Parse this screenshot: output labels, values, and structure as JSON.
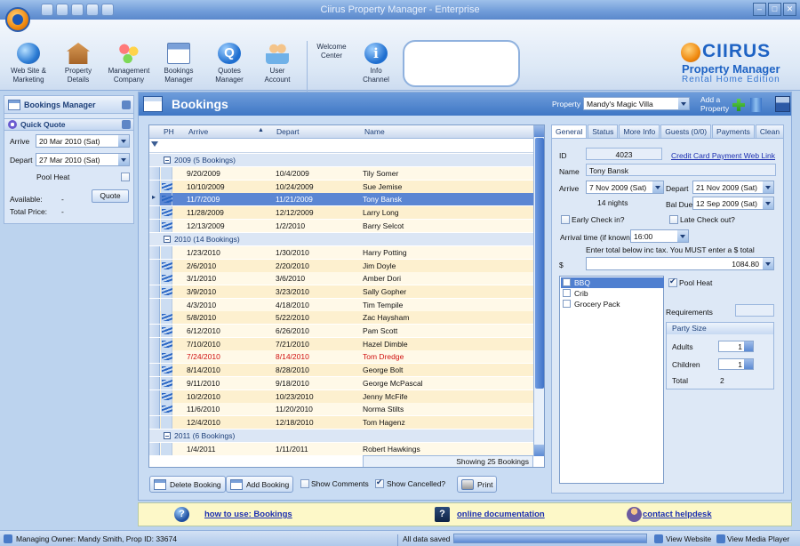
{
  "window": {
    "title": "Ciirus Property Manager  -  Enterprise"
  },
  "ribbon": {
    "buttons": [
      {
        "line1": "Web Site &",
        "line2": "Marketing",
        "icon": "globe-icon"
      },
      {
        "line1": "Property",
        "line2": "Details",
        "icon": "house-icon"
      },
      {
        "line1": "Management",
        "line2": "Company",
        "icon": "management-icon"
      },
      {
        "line1": "Bookings",
        "line2": "Manager",
        "icon": "calendar-icon"
      },
      {
        "line1": "Quotes",
        "line2": "Manager",
        "icon": "quotes-icon"
      },
      {
        "line1": "User",
        "line2": "Account",
        "icon": "user-icon"
      },
      {
        "line1": "Welcome",
        "line2": "Center",
        "icon": "help-icon"
      },
      {
        "line1": "Info",
        "line2": "Channel",
        "icon": "info-icon"
      }
    ],
    "logo": {
      "brand": "CIIRUS",
      "line1": "Property Manager",
      "line2": "Rental Home Edition"
    }
  },
  "left_panel": {
    "title": "Bookings Manager",
    "quick_quote": "Quick Quote",
    "arrive_label": "Arrive",
    "arrive_value": "20 Mar 2010 (Sat)",
    "depart_label": "Depart",
    "depart_value": "27 Mar 2010 (Sat)",
    "pool_heat": "Pool Heat",
    "quote_button": "Quote",
    "available_label": "Available:",
    "available_value": "-",
    "total_label": "Total Price:",
    "total_value": "-"
  },
  "main": {
    "title": "Bookings",
    "property_label": "Property",
    "property_value": "Mandy's Magic Villa",
    "add_property_1": "Add a",
    "add_property_2": "Property"
  },
  "grid": {
    "columns": {
      "ph": "PH",
      "arrive": "Arrive",
      "depart": "Depart",
      "name": "Name"
    },
    "groups": [
      {
        "label": "2009  (5 Bookings)",
        "rows": [
          {
            "arrive": "9/20/2009",
            "depart": "10/4/2009",
            "name": "Tily Somer",
            "ph": false
          },
          {
            "arrive": "10/10/2009",
            "depart": "10/24/2009",
            "name": "Sue Jemise",
            "ph": true
          },
          {
            "arrive": "11/7/2009",
            "depart": "11/21/2009",
            "name": "Tony Bansk",
            "ph": true,
            "selected": true
          },
          {
            "arrive": "11/28/2009",
            "depart": "12/12/2009",
            "name": "Larry Long",
            "ph": true
          },
          {
            "arrive": "12/13/2009",
            "depart": "1/2/2010",
            "name": "Barry Selcot",
            "ph": true
          }
        ]
      },
      {
        "label": "2010  (14 Bookings)",
        "rows": [
          {
            "arrive": "1/23/2010",
            "depart": "1/30/2010",
            "name": "Harry Potting",
            "ph": false
          },
          {
            "arrive": "2/6/2010",
            "depart": "2/20/2010",
            "name": "Jim Doyle",
            "ph": true
          },
          {
            "arrive": "3/1/2010",
            "depart": "3/6/2010",
            "name": "Amber Dori",
            "ph": true
          },
          {
            "arrive": "3/9/2010",
            "depart": "3/23/2010",
            "name": "Sally Gopher",
            "ph": true
          },
          {
            "arrive": "4/3/2010",
            "depart": "4/18/2010",
            "name": "Tim Tempile",
            "ph": false
          },
          {
            "arrive": "5/8/2010",
            "depart": "5/22/2010",
            "name": "Zac Haysham",
            "ph": true
          },
          {
            "arrive": "6/12/2010",
            "depart": "6/26/2010",
            "name": "Pam Scott",
            "ph": true
          },
          {
            "arrive": "7/10/2010",
            "depart": "7/21/2010",
            "name": "Hazel Dimble",
            "ph": true
          },
          {
            "arrive": "7/24/2010",
            "depart": "8/14/2010",
            "name": "Tom Dredge",
            "ph": true,
            "red": true
          },
          {
            "arrive": "8/14/2010",
            "depart": "8/28/2010",
            "name": "George Bolt",
            "ph": true
          },
          {
            "arrive": "9/11/2010",
            "depart": "9/18/2010",
            "name": "George McPascal",
            "ph": true
          },
          {
            "arrive": "10/2/2010",
            "depart": "10/23/2010",
            "name": "Jenny McFife",
            "ph": true
          },
          {
            "arrive": "11/6/2010",
            "depart": "11/20/2010",
            "name": "Norma Stilts",
            "ph": true
          },
          {
            "arrive": "12/4/2010",
            "depart": "12/18/2010",
            "name": "Tom Hagenz",
            "ph": false
          }
        ]
      },
      {
        "label": "2011  (6 Bookings)",
        "rows": [
          {
            "arrive": "1/4/2011",
            "depart": "1/11/2011",
            "name": "Robert Hawkings",
            "ph": false
          }
        ]
      }
    ],
    "footer": "Showing 25 Bookings"
  },
  "detail": {
    "tabs": [
      "General",
      "Status",
      "More Info",
      "Guests (0/0)",
      "Payments",
      "Clean"
    ],
    "id_label": "ID",
    "id_value": "4023",
    "cc_link": "Credit Card Payment Web Link",
    "name_label": "Name",
    "name_value": "Tony Bansk",
    "arrive_label": "Arrive",
    "arrive_value": "7 Nov 2009 (Sat)",
    "depart_label": "Depart",
    "depart_value": "21 Nov 2009 (Sat)",
    "nights": "14 nights",
    "bal_due_label": "Bal Due",
    "bal_due_value": "12 Sep 2009 (Sat)",
    "early_checkin": "Early Check in?",
    "late_checkout": "Late Check out?",
    "arrival_time_label": "Arrival time (if known)",
    "arrival_time_value": "16:00",
    "total_note": "Enter total below inc tax. You MUST enter a $ total",
    "dollar": "$",
    "total_value": "1084.80",
    "extras": [
      "BBQ",
      "Crib",
      "Grocery Pack"
    ],
    "pool_heat": "Pool Heat",
    "requirements": "Requirements",
    "party_size": "Party Size",
    "adults_label": "Adults",
    "adults_value": "1",
    "children_label": "Children",
    "children_value": "1",
    "total_label": "Total",
    "total_party": "2"
  },
  "actions": {
    "delete": "Delete Booking",
    "add": "Add Booking",
    "show_comments": "Show Comments",
    "show_cancelled": "Show Cancelled?",
    "print": "Print"
  },
  "help": {
    "how_to": "how to use: Bookings",
    "docs": "online documentation",
    "helpdesk": "contact helpdesk"
  },
  "status": {
    "owner": "Managing Owner: Mandy Smith, Prop ID: 33674",
    "saved": "All data saved",
    "view_website": "View Website",
    "view_media": "View Media Player"
  }
}
